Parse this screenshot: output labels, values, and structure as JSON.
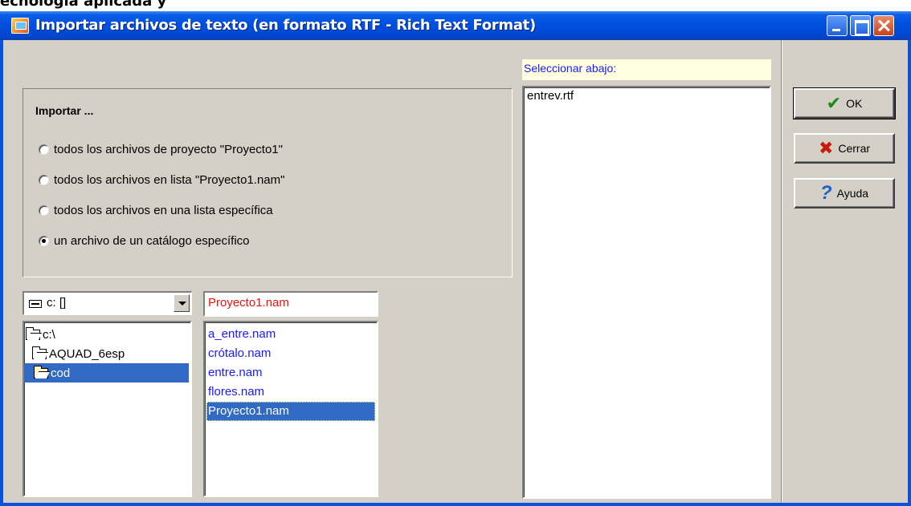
{
  "top_strip": {
    "text": "ecnología aplicada y"
  },
  "window": {
    "title": "Importar archivos de texto (en formato RTF - Rich Text Format)",
    "controls": [
      "minimize",
      "maximize",
      "close"
    ]
  },
  "import_group": {
    "title": "Importar ...",
    "options": [
      {
        "label": "todos los archivos de proyecto \"Proyecto1\"",
        "selected": false
      },
      {
        "label": "todos los archivos en lista \"Proyecto1.nam\"",
        "selected": false
      },
      {
        "label": "todos los archivos en una lista específica",
        "selected": false
      },
      {
        "label": "un archivo de un catálogo específico",
        "selected": true
      }
    ]
  },
  "drive_select": {
    "value": "c: []"
  },
  "directories": [
    {
      "label": "c:\\",
      "selected": false
    },
    {
      "label": "AQUAD_6esp",
      "selected": false
    },
    {
      "label": "cod",
      "selected": true
    }
  ],
  "name_field": {
    "value": "Proyecto1.nam"
  },
  "files": [
    {
      "label": "a_entre.nam",
      "selected": false
    },
    {
      "label": "crótalo.nam",
      "selected": false
    },
    {
      "label": "entre.nam",
      "selected": false
    },
    {
      "label": "flores.nam",
      "selected": false
    },
    {
      "label": "Proyecto1.nam",
      "selected": true
    }
  ],
  "select_below": {
    "label": "Seleccionar abajo:",
    "items": [
      "entrev.rtf"
    ]
  },
  "buttons": {
    "ok": {
      "label": "OK",
      "icon": "check-icon"
    },
    "close": {
      "label": "Cerrar",
      "icon": "x-icon"
    },
    "help": {
      "label": "Ayuda",
      "icon": "question-icon"
    }
  },
  "colors": {
    "titlebar": "#0050e0",
    "dialog_bg": "#d4d0c8",
    "selection": "#316ac5",
    "file_text": "#1a1aff",
    "name_field_text": "#e8140c",
    "label_bg": "#ffffe1"
  }
}
